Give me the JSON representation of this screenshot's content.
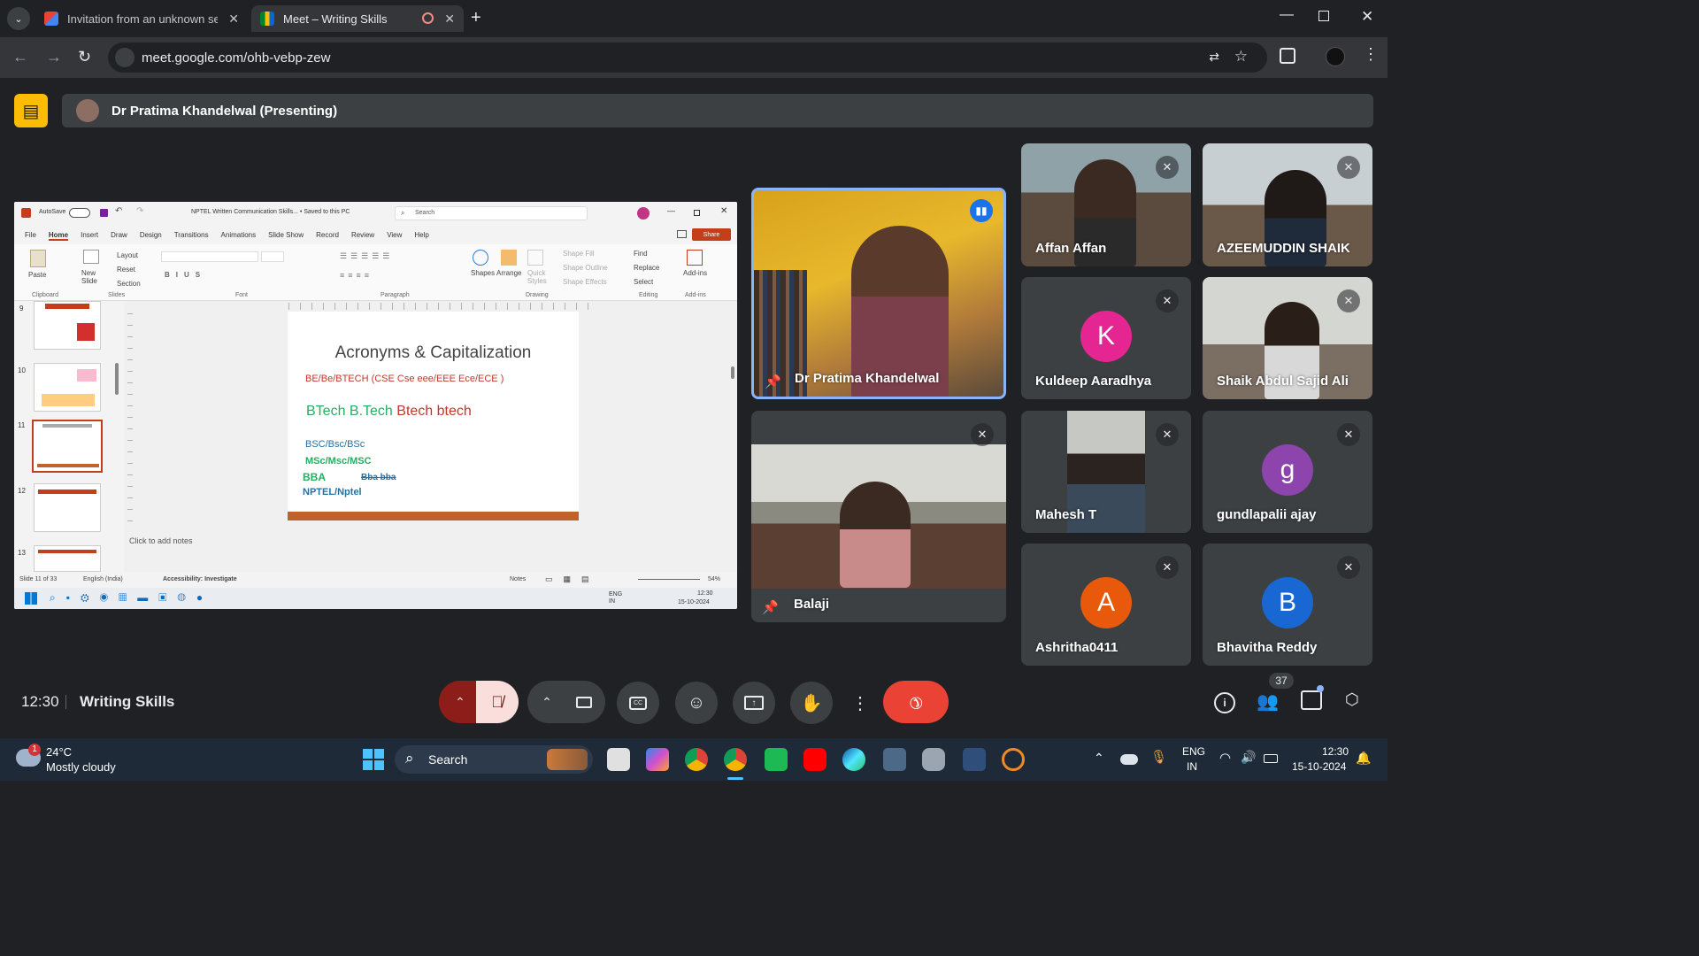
{
  "browser": {
    "tabs": [
      {
        "title": "Invitation from an unknown sen"
      },
      {
        "title": "Meet – Writing Skills"
      }
    ],
    "url": "meet.google.com/ohb-vebp-zew"
  },
  "meet": {
    "presenting_banner": "Dr Pratima Khandelwal (Presenting)",
    "time": "12:30",
    "meeting_title": "Writing Skills",
    "participant_count": "37",
    "participants": [
      {
        "name": "Dr Pratima Khandelwal",
        "pinned": true,
        "speaking": true
      },
      {
        "name": "Balaji",
        "pinned": true
      },
      {
        "name": "Affan Affan"
      },
      {
        "name": "AZEEMUDDIN SHAIK"
      },
      {
        "name": "Kuldeep Aaradhya",
        "initial": "K",
        "color": "#e52592"
      },
      {
        "name": "Shaik Abdul Sajid Ali"
      },
      {
        "name": "Mahesh T"
      },
      {
        "name": "gundlapalii ajay",
        "initial": "g",
        "color": "#8e44ad"
      },
      {
        "name": "Ashritha0411",
        "initial": "A",
        "color": "#e8590c"
      },
      {
        "name": "Bhavitha Reddy",
        "initial": "B",
        "color": "#1967d2"
      }
    ]
  },
  "ppt": {
    "autosave": "AutoSave",
    "doc_title": "NPTEL Written Communication Skills... • Saved to this PC",
    "search": "Search",
    "menu": [
      "File",
      "Home",
      "Insert",
      "Draw",
      "Design",
      "Transitions",
      "Animations",
      "Slide Show",
      "Record",
      "Review",
      "View",
      "Help"
    ],
    "share": "Share",
    "ribbon": {
      "paste": "Paste",
      "new_slide": "New Slide",
      "layout": "Layout",
      "reset": "Reset",
      "section": "Section",
      "shapes": "Shapes",
      "arrange": "Arrange",
      "quick_styles": "Quick Styles",
      "shape_fill": "Shape Fill",
      "shape_outline": "Shape Outline",
      "shape_effects": "Shape Effects",
      "find": "Find",
      "replace": "Replace",
      "select": "Select",
      "addins": "Add-ins",
      "groups": [
        "Clipboard",
        "Slides",
        "Font",
        "Paragraph",
        "Drawing",
        "Editing",
        "Add-ins"
      ]
    },
    "slide_numbers": [
      "9",
      "10",
      "11",
      "12",
      "13"
    ],
    "slide": {
      "title": "Acronyms & Capitalization",
      "line1": "BE/Be/BTECH (CSE Cse eee/EEE Ece/ECE )",
      "line2_green": "BTech B.Tech",
      "line2_red": "Btech btech",
      "line3": "BSC/Bsc/BSc",
      "line4": "MSc/Msc/MSC",
      "line5_a": "BBA",
      "line5_b": "Bba bba",
      "line6": "NPTEL/Nptel"
    },
    "notes": "Click to add notes",
    "status": {
      "slide": "Slide 11 of 33",
      "lang": "English (India)",
      "accessibility": "Accessibility: Investigate",
      "notes": "Notes",
      "zoom": "54%"
    },
    "inner_taskbar": {
      "lang": "ENG IN",
      "time": "12:30",
      "date": "15-10-2024"
    }
  },
  "taskbar": {
    "weather_temp": "24°C",
    "weather_desc": "Mostly cloudy",
    "search": "Search",
    "lang1": "ENG",
    "lang2": "IN",
    "time": "12:30",
    "date": "15-10-2024",
    "notification_badge": "1"
  },
  "colors": {
    "end_call": "#ea4335",
    "mic_off": "#f9dedc",
    "accent_blue": "#8ab4f8"
  }
}
